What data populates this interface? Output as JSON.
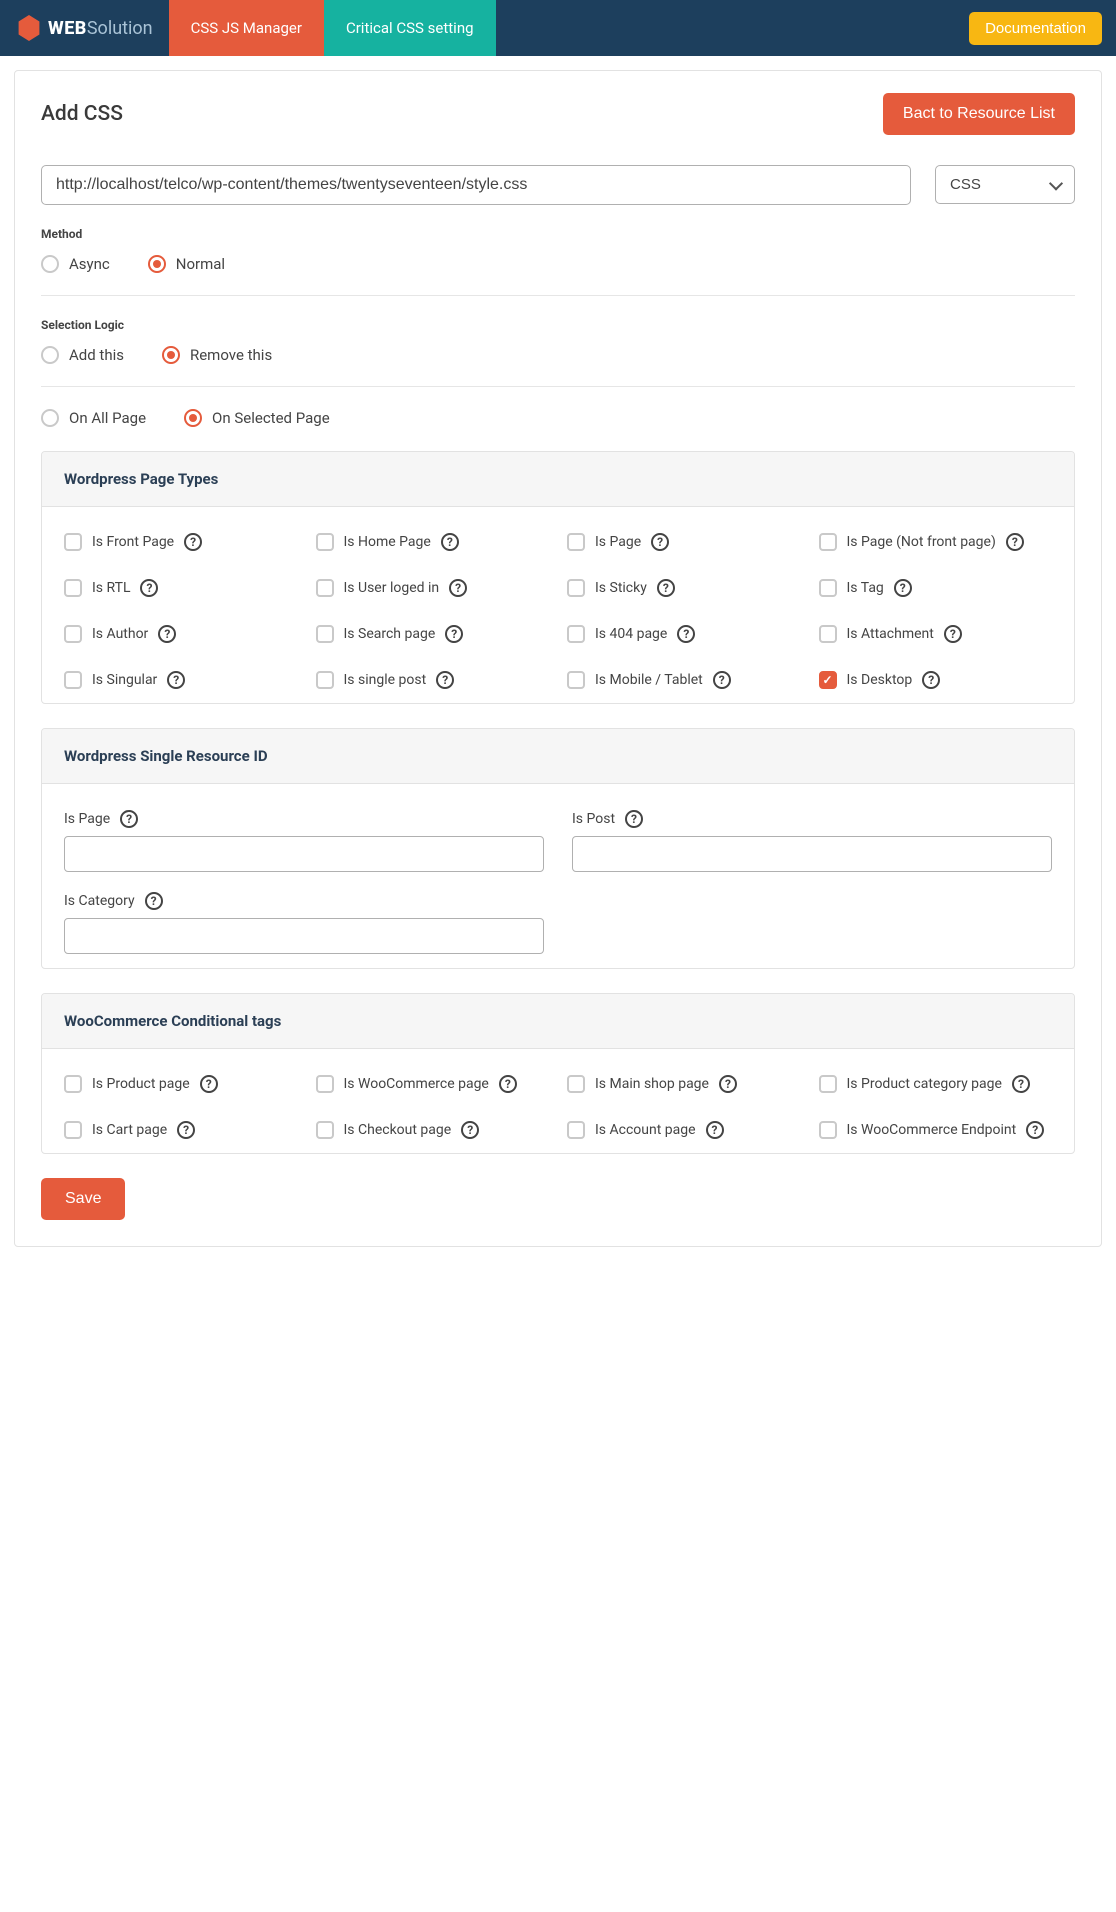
{
  "topbar": {
    "brand_web": "WEB",
    "brand_solution": "Solution",
    "tab_css_js": "CSS JS Manager",
    "tab_critical": "Critical CSS setting",
    "doc_btn": "Documentation"
  },
  "header": {
    "title": "Add CSS",
    "back_btn": "Bact to Resource List"
  },
  "url_row": {
    "url_value": "http://localhost/telco/wp-content/themes/twentyseventeen/style.css",
    "type_value": "CSS"
  },
  "method": {
    "label": "Method",
    "options": [
      {
        "key": "async",
        "label": "Async",
        "checked": false
      },
      {
        "key": "normal",
        "label": "Normal",
        "checked": true
      }
    ]
  },
  "selection_logic": {
    "label": "Selection Logic",
    "row1": [
      {
        "key": "add-this",
        "label": "Add this",
        "checked": false
      },
      {
        "key": "remove-this",
        "label": "Remove this",
        "checked": true
      }
    ],
    "row2": [
      {
        "key": "on-all-page",
        "label": "On All Page",
        "checked": false
      },
      {
        "key": "on-selected-page",
        "label": "On Selected Page",
        "checked": true
      }
    ]
  },
  "panels": {
    "page_types": {
      "title": "Wordpress Page Types",
      "items": [
        {
          "label": "Is Front Page",
          "checked": false
        },
        {
          "label": "Is Home Page",
          "checked": false
        },
        {
          "label": "Is Page",
          "checked": false
        },
        {
          "label": "Is Page (Not front page)",
          "checked": false
        },
        {
          "label": "Is RTL",
          "checked": false
        },
        {
          "label": "Is User loged in",
          "checked": false
        },
        {
          "label": "Is Sticky",
          "checked": false
        },
        {
          "label": "Is Tag",
          "checked": false
        },
        {
          "label": "Is Author",
          "checked": false
        },
        {
          "label": "Is Search page",
          "checked": false
        },
        {
          "label": "Is 404 page",
          "checked": false
        },
        {
          "label": "Is Attachment",
          "checked": false
        },
        {
          "label": "Is Singular",
          "checked": false
        },
        {
          "label": "Is single post",
          "checked": false
        },
        {
          "label": "Is Mobile / Tablet",
          "checked": false
        },
        {
          "label": "Is Desktop",
          "checked": true
        }
      ]
    },
    "resource_id": {
      "title": "Wordpress Single Resource ID",
      "fields": [
        {
          "label": "Is Page",
          "value": ""
        },
        {
          "label": "Is Post",
          "value": ""
        },
        {
          "label": "Is Category",
          "value": ""
        }
      ]
    },
    "woo": {
      "title": "WooCommerce Conditional tags",
      "items": [
        {
          "label": "Is Product page",
          "checked": false
        },
        {
          "label": "Is WooCommerce page",
          "checked": false
        },
        {
          "label": "Is Main shop page",
          "checked": false
        },
        {
          "label": "Is Product category page",
          "checked": false
        },
        {
          "label": "Is Cart page",
          "checked": false
        },
        {
          "label": "Is Checkout page",
          "checked": false
        },
        {
          "label": "Is Account page",
          "checked": false
        },
        {
          "label": "Is WooCommerce Endpoint",
          "checked": false
        }
      ]
    }
  },
  "save_btn": "Save"
}
